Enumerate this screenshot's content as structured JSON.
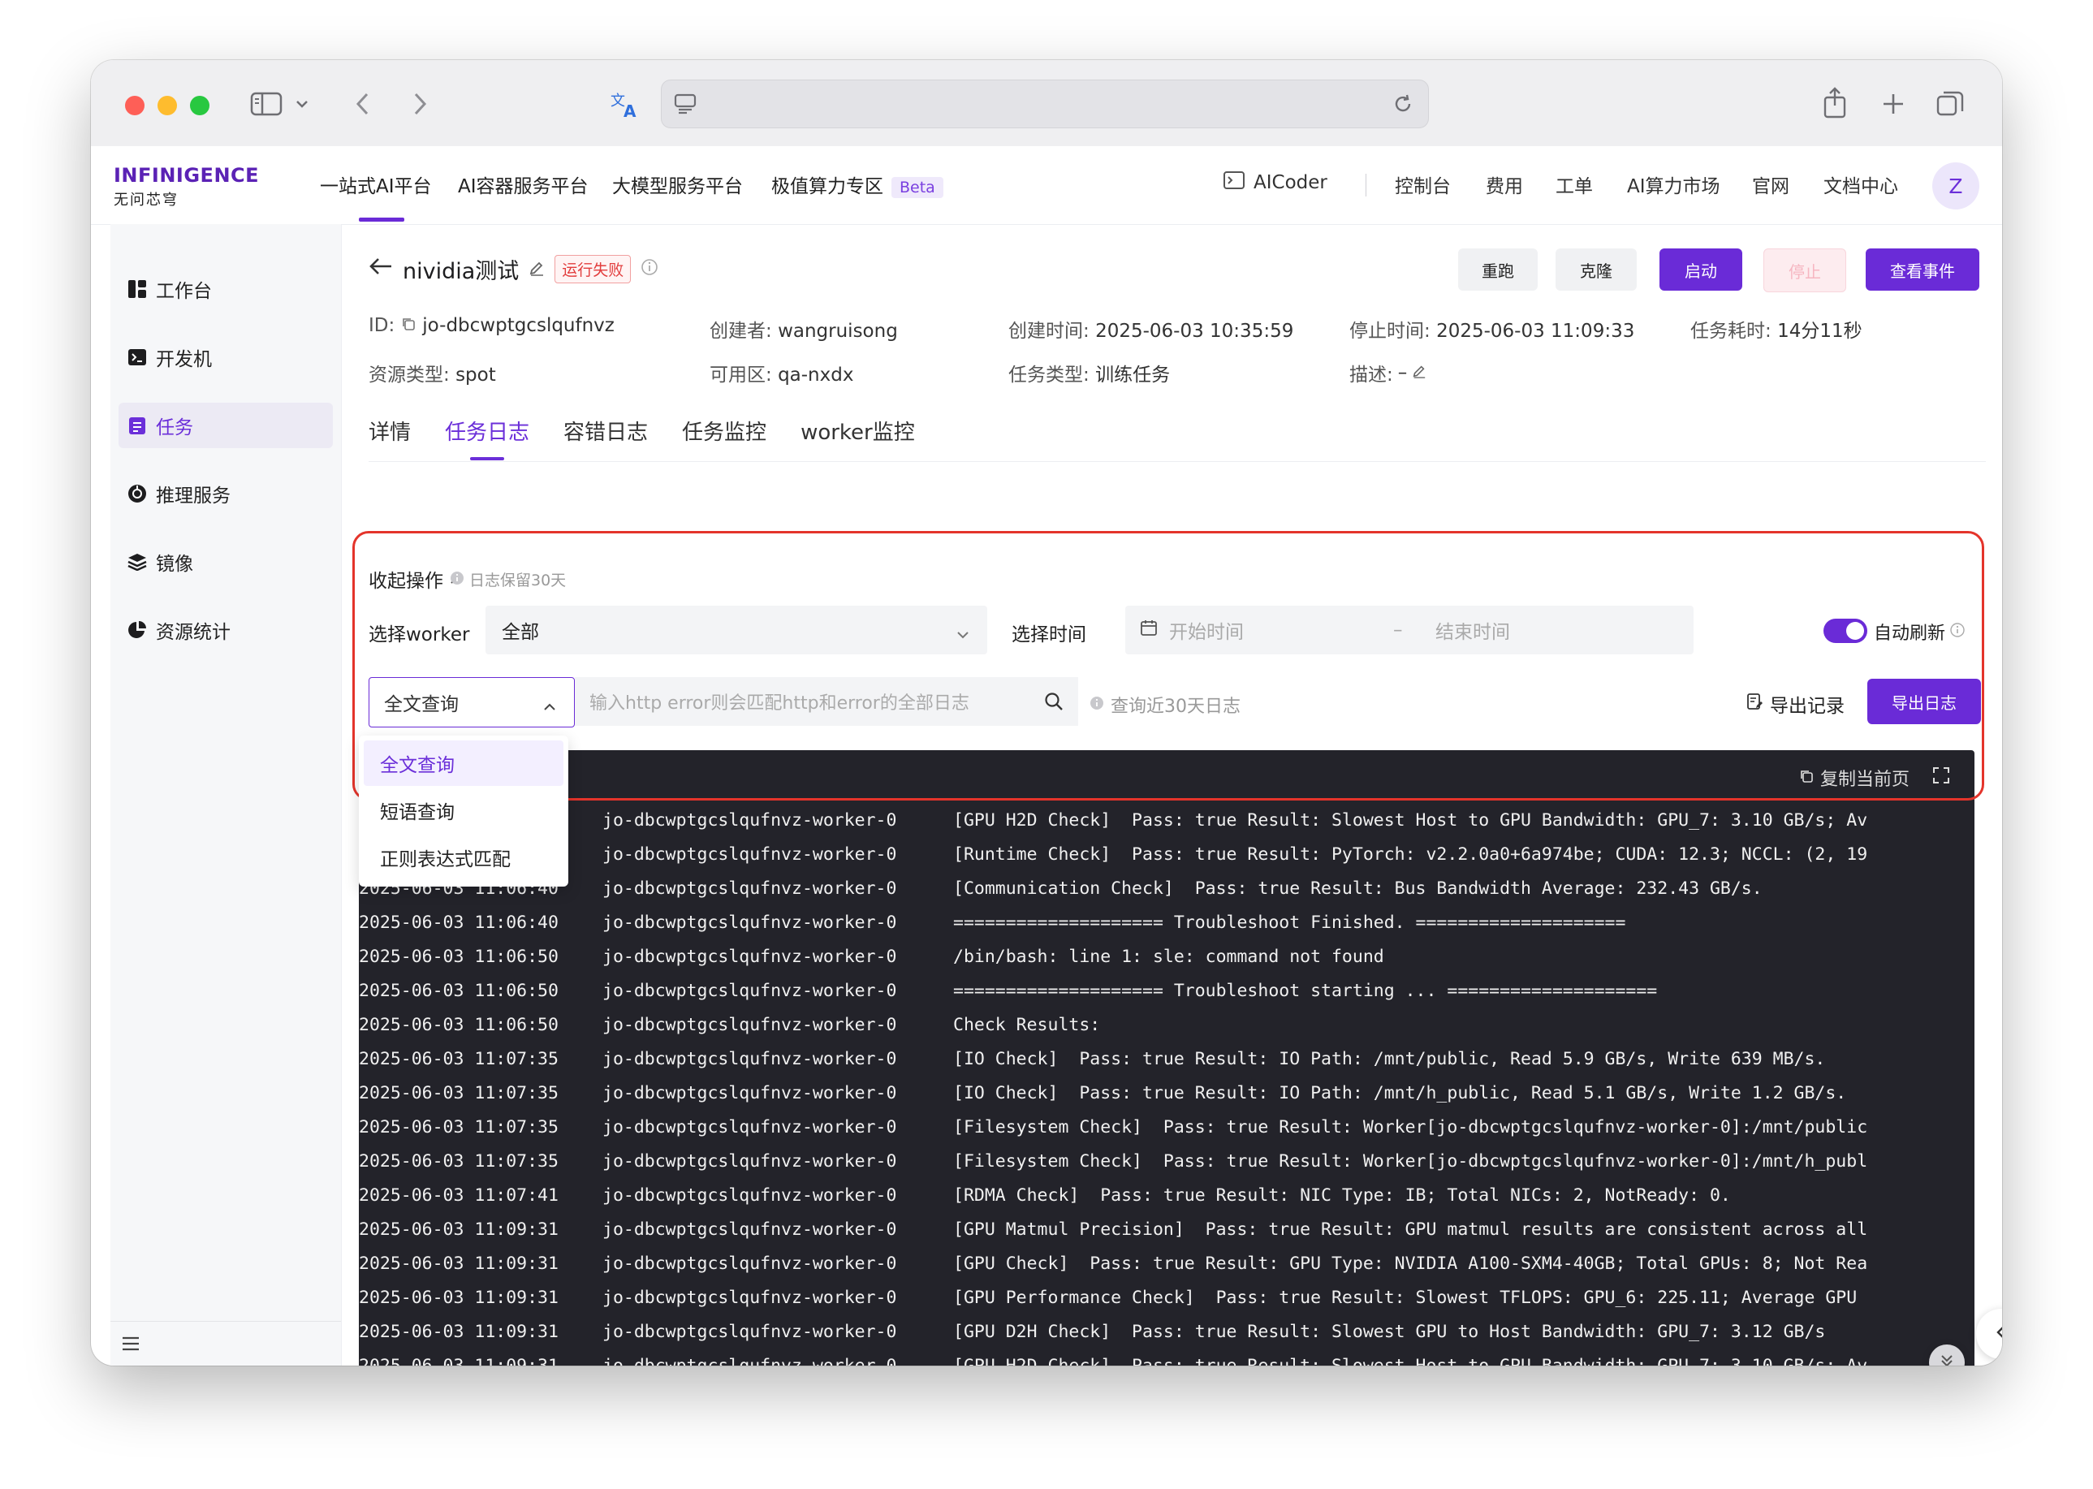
{
  "header": {
    "logo_main": "INFINIGENCE",
    "logo_sub": "无问芯穹",
    "nav": [
      "一站式AI平台",
      "AI容器服务平台",
      "大模型服务平台",
      "极值算力专区"
    ],
    "nav_badge": "Beta",
    "aicoder": "AICoder",
    "links": [
      "控制台",
      "费用",
      "工单",
      "AI算力市场",
      "官网",
      "文档中心"
    ],
    "avatar": "Z"
  },
  "sidebar": {
    "items": [
      {
        "label": "工作台",
        "icon": "dashboard-icon"
      },
      {
        "label": "开发机",
        "icon": "terminal-icon"
      },
      {
        "label": "任务",
        "icon": "task-icon"
      },
      {
        "label": "推理服务",
        "icon": "inference-icon"
      },
      {
        "label": "镜像",
        "icon": "layers-icon"
      },
      {
        "label": "资源统计",
        "icon": "pie-chart-icon"
      }
    ],
    "active_index": 2
  },
  "job": {
    "title": "nividia测试",
    "status": "运行失败",
    "buttons": {
      "rerun": "重跑",
      "clone": "克隆",
      "start": "启动",
      "stop": "停止",
      "events": "查看事件"
    },
    "id_label": "ID:",
    "id_value": "jo-dbcwptgcslqufnvz",
    "creator_label": "创建者:",
    "creator_value": "wangruisong",
    "created_label": "创建时间:",
    "created_value": "2025-06-03 10:35:59",
    "stopped_label": "停止时间:",
    "stopped_value": "2025-06-03 11:09:33",
    "duration_label": "任务耗时:",
    "duration_value": "14分11秒",
    "resource_label": "资源类型:",
    "resource_value": "spot",
    "zone_label": "可用区:",
    "zone_value": "qa-nxdx",
    "type_label": "任务类型:",
    "type_value": "训练任务",
    "desc_label": "描述:",
    "desc_value": "–"
  },
  "tabs": [
    "详情",
    "任务日志",
    "容错日志",
    "任务监控",
    "worker监控"
  ],
  "active_tab": 1,
  "log_panel": {
    "collapse_label": "收起操作",
    "retention_note": "日志保留30天",
    "worker_label": "选择worker",
    "worker_value": "全部",
    "time_label": "选择时间",
    "start_placeholder": "开始时间",
    "end_placeholder": "结束时间",
    "range_sep": "–",
    "auto_refresh_label": "自动刷新",
    "query_mode": "全文查询",
    "query_modes": [
      "全文查询",
      "短语查询",
      "正则表达式匹配"
    ],
    "search_placeholder": "输入http error则会匹配http和error的全部日志",
    "query_note": "查询近30天日志",
    "export_records": "导出记录",
    "export_logs": "导出日志",
    "copy_page": "复制当前页"
  },
  "logs": [
    {
      "ts": "",
      "worker": "jo-dbcwptgcslqufnvz-worker-0",
      "msg": "[GPU H2D Check]  Pass: true Result: Slowest Host to GPU Bandwidth: GPU_7: 3.10 GB/s; Av"
    },
    {
      "ts": "",
      "worker": "jo-dbcwptgcslqufnvz-worker-0",
      "msg": "[Runtime Check]  Pass: true Result: PyTorch: v2.2.0a0+6a974be; CUDA: 12.3; NCCL: (2, 19"
    },
    {
      "ts": "2025-06-03 11:06:40",
      "worker": "jo-dbcwptgcslqufnvz-worker-0",
      "msg": "[Communication Check]  Pass: true Result: Bus Bandwidth Average: 232.43 GB/s."
    },
    {
      "ts": "2025-06-03 11:06:40",
      "worker": "jo-dbcwptgcslqufnvz-worker-0",
      "msg": "==================== Troubleshoot Finished. ===================="
    },
    {
      "ts": "2025-06-03 11:06:50",
      "worker": "jo-dbcwptgcslqufnvz-worker-0",
      "msg": "/bin/bash: line 1: sle: command not found"
    },
    {
      "ts": "2025-06-03 11:06:50",
      "worker": "jo-dbcwptgcslqufnvz-worker-0",
      "msg": "==================== Troubleshoot starting ... ===================="
    },
    {
      "ts": "2025-06-03 11:06:50",
      "worker": "jo-dbcwptgcslqufnvz-worker-0",
      "msg": "Check Results:"
    },
    {
      "ts": "2025-06-03 11:07:35",
      "worker": "jo-dbcwptgcslqufnvz-worker-0",
      "msg": "[IO Check]  Pass: true Result: IO Path: /mnt/public, Read 5.9 GB/s, Write 639 MB/s."
    },
    {
      "ts": "2025-06-03 11:07:35",
      "worker": "jo-dbcwptgcslqufnvz-worker-0",
      "msg": "[IO Check]  Pass: true Result: IO Path: /mnt/h_public, Read 5.1 GB/s, Write 1.2 GB/s."
    },
    {
      "ts": "2025-06-03 11:07:35",
      "worker": "jo-dbcwptgcslqufnvz-worker-0",
      "msg": "[Filesystem Check]  Pass: true Result: Worker[jo-dbcwptgcslqufnvz-worker-0]:/mnt/public"
    },
    {
      "ts": "2025-06-03 11:07:35",
      "worker": "jo-dbcwptgcslqufnvz-worker-0",
      "msg": "[Filesystem Check]  Pass: true Result: Worker[jo-dbcwptgcslqufnvz-worker-0]:/mnt/h_publ"
    },
    {
      "ts": "2025-06-03 11:07:41",
      "worker": "jo-dbcwptgcslqufnvz-worker-0",
      "msg": "[RDMA Check]  Pass: true Result: NIC Type: IB; Total NICs: 2, NotReady: 0."
    },
    {
      "ts": "2025-06-03 11:09:31",
      "worker": "jo-dbcwptgcslqufnvz-worker-0",
      "msg": "[GPU Matmul Precision]  Pass: true Result: GPU matmul results are consistent across all"
    },
    {
      "ts": "2025-06-03 11:09:31",
      "worker": "jo-dbcwptgcslqufnvz-worker-0",
      "msg": "[GPU Check]  Pass: true Result: GPU Type: NVIDIA A100-SXM4-40GB; Total GPUs: 8; Not Rea"
    },
    {
      "ts": "2025-06-03 11:09:31",
      "worker": "jo-dbcwptgcslqufnvz-worker-0",
      "msg": "[GPU Performance Check]  Pass: true Result: Slowest TFLOPS: GPU_6: 225.11; Average GPU"
    },
    {
      "ts": "2025-06-03 11:09:31",
      "worker": "jo-dbcwptgcslqufnvz-worker-0",
      "msg": "[GPU D2H Check]  Pass: true Result: Slowest GPU to Host Bandwidth: GPU_7: 3.12 GB/s"
    },
    {
      "ts": "2025-06-03 11:09:31",
      "worker": "jo-dbcwptgcslqufnvz-worker-0",
      "msg": "[GPU H2D Check]  Pass: true Result: Slowest Host to GPU Bandwidth: GPU_7: 3.10 GB/s; Av"
    }
  ],
  "colors": {
    "accent": "#6a2bd7",
    "danger": "#e4342b",
    "console_bg": "#23232a"
  }
}
